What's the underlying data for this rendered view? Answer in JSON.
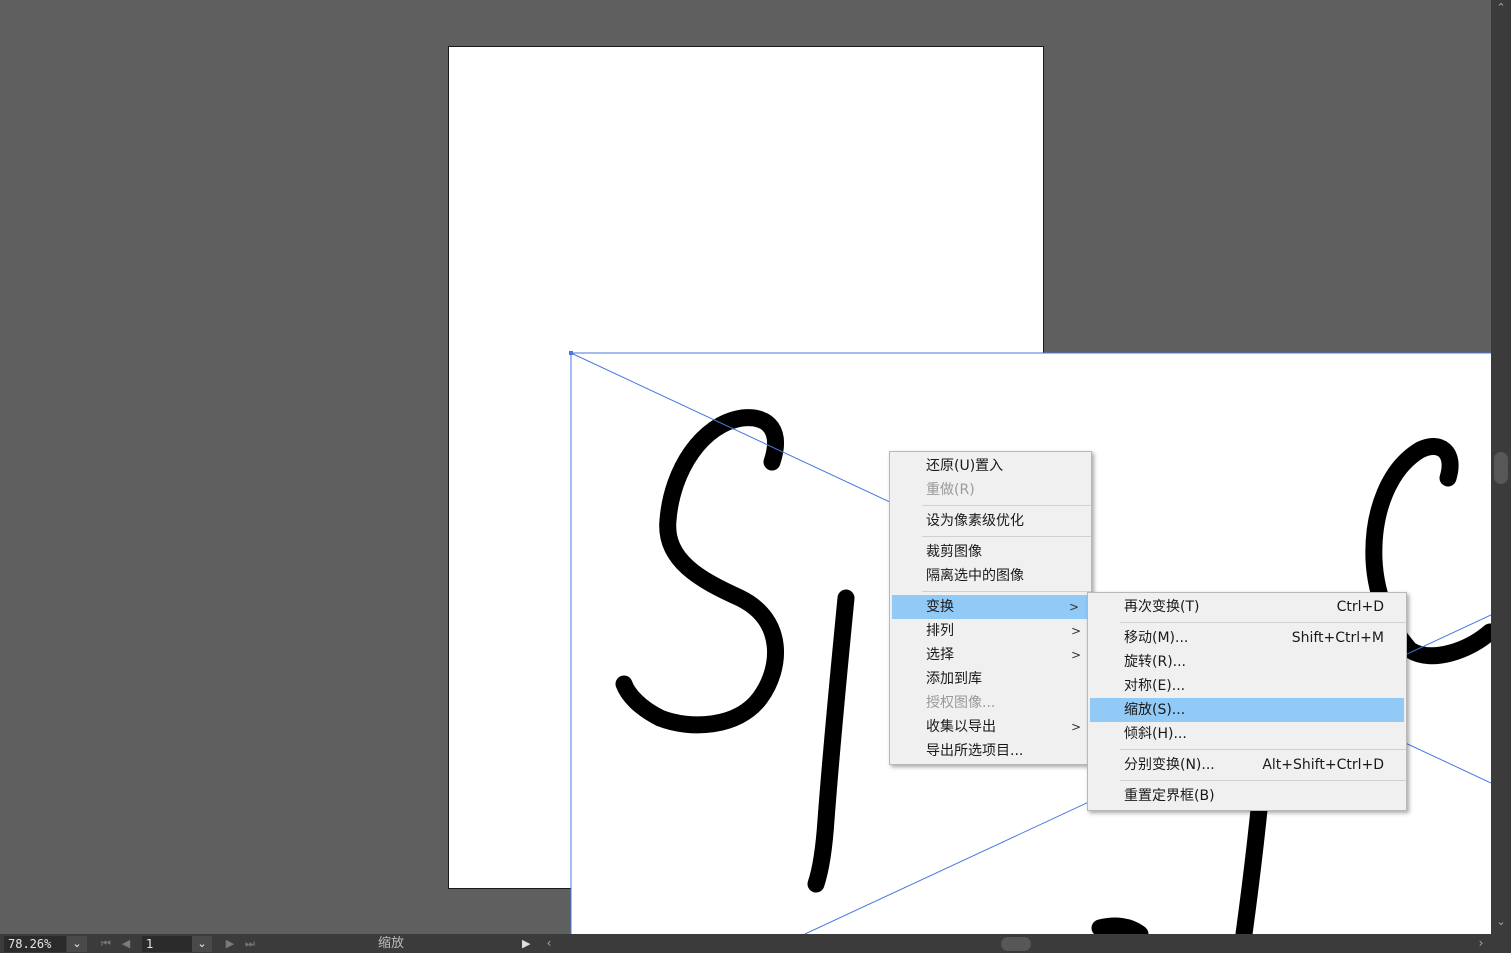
{
  "status_bar": {
    "zoom": "78.26%",
    "page": "1",
    "tool_status": "缩放"
  },
  "context_menu": {
    "items": [
      {
        "label": "还原(U)置入",
        "enabled": true
      },
      {
        "label": "重做(R)",
        "enabled": false
      },
      {
        "label": "设为像素级优化",
        "enabled": true
      },
      {
        "label": "裁剪图像",
        "enabled": true
      },
      {
        "label": "隔离选中的图像",
        "enabled": true
      },
      {
        "label": "变换",
        "enabled": true,
        "submenu": true
      },
      {
        "label": "排列",
        "enabled": true,
        "submenu": true
      },
      {
        "label": "选择",
        "enabled": true,
        "submenu": true
      },
      {
        "label": "添加到库",
        "enabled": true
      },
      {
        "label": "授权图像...",
        "enabled": false
      },
      {
        "label": "收集以导出",
        "enabled": true,
        "submenu": true
      },
      {
        "label": "导出所选项目...",
        "enabled": true
      }
    ]
  },
  "transform_submenu": {
    "items": [
      {
        "label": "再次变换(T)",
        "shortcut": "Ctrl+D"
      },
      {
        "label": "移动(M)...",
        "shortcut": "Shift+Ctrl+M"
      },
      {
        "label": "旋转(R)...",
        "shortcut": ""
      },
      {
        "label": "对称(E)...",
        "shortcut": ""
      },
      {
        "label": "缩放(S)...",
        "shortcut": ""
      },
      {
        "label": "倾斜(H)...",
        "shortcut": ""
      },
      {
        "label": "分别变换(N)...",
        "shortcut": "Alt+Shift+Ctrl+D"
      },
      {
        "label": "重置定界框(B)",
        "shortcut": ""
      }
    ]
  },
  "icons": {
    "submenu_arrow": "chevron-right-icon",
    "dropdown": "chevron-down-icon",
    "first_page": "first-page-icon",
    "prev_page": "prev-page-icon",
    "next_page": "next-page-icon",
    "last_page": "last-page-icon"
  },
  "colors": {
    "pasteboard": "#5f5f5f",
    "menu_highlight": "#91c9f7",
    "selection": "#4a78e0"
  }
}
